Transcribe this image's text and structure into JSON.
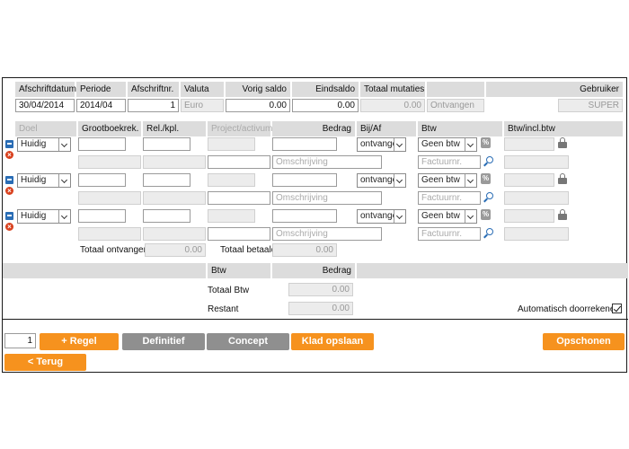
{
  "header": {
    "afschriftdatum_label": "Afschriftdatum",
    "periode_label": "Periode",
    "afschriftnr_label": "Afschriftnr.",
    "valuta_label": "Valuta",
    "vorig_saldo_label": "Vorig saldo",
    "eindsaldo_label": "Eindsaldo",
    "totaal_mutaties_label": "Totaal mutaties",
    "gebruiker_label": "Gebruiker",
    "afschriftdatum": "30/04/2014",
    "periode": "2014/04",
    "afschriftnr": "1",
    "valuta": "Euro",
    "vorig_saldo": "0.00",
    "eindsaldo": "0.00",
    "totaal_mutaties": "0.00",
    "status": "Ontvangen",
    "gebruiker": "SUPER"
  },
  "columns": {
    "doel": "Doel",
    "grootboek": "Grootboekrek.",
    "relkpl": "Rel./kpl.",
    "project": "Project/activum",
    "bedrag": "Bedrag",
    "bijaf": "Bij/Af",
    "btw": "Btw",
    "btw_incl": "Btw/incl.btw"
  },
  "rows": [
    {
      "doel": "Huidig",
      "bijaf": "ontvangen",
      "btw": "Geen btw",
      "omschrijving_placeholder": "Omschrijving",
      "factuurnr_placeholder": "Factuurnr."
    },
    {
      "doel": "Huidig",
      "bijaf": "ontvangen",
      "btw": "Geen btw",
      "omschrijving_placeholder": "Omschrijving",
      "factuurnr_placeholder": "Factuurnr."
    },
    {
      "doel": "Huidig",
      "bijaf": "ontvangen",
      "btw": "Geen btw",
      "omschrijving_placeholder": "Omschrijving",
      "factuurnr_placeholder": "Factuurnr."
    }
  ],
  "totals": {
    "totaal_ontvangen_label": "Totaal ontvangen",
    "totaal_ontvangen": "0.00",
    "totaal_betaald_label": "Totaal betaald",
    "totaal_betaald": "0.00"
  },
  "summary": {
    "btw_label": "Btw",
    "bedrag_label": "Bedrag",
    "totaal_btw_label": "Totaal Btw",
    "totaal_btw": "0.00",
    "restant_label": "Restant",
    "restant": "0.00",
    "auto_label": "Automatisch doorrekenen",
    "auto_checked": true
  },
  "footer": {
    "line_count": "1",
    "regel_label": "+ Regel",
    "definitief_label": "Definitief",
    "concept_label": "Concept",
    "klad_label": "Klad opslaan",
    "schonen_label": "Opschonen",
    "terug_label": "< Terug"
  },
  "colors": {
    "accent": "#f6921e",
    "disabled_button": "#8f8f8f",
    "header_band": "#dcdcdc"
  }
}
